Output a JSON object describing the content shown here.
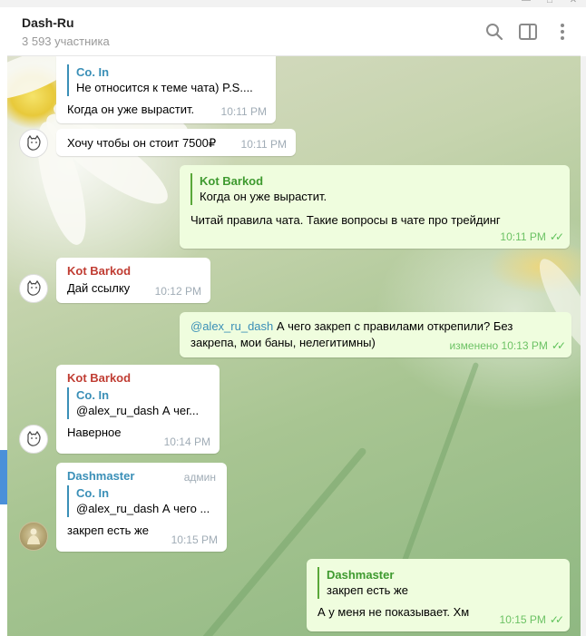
{
  "header": {
    "title": "Dash-Ru",
    "subtitle": "3 593 участника"
  },
  "icons": [
    "search-icon",
    "sidebar-toggle-icon",
    "more-vertical-icon",
    "avatar-cat-icon"
  ],
  "messages": [
    {
      "reply": {
        "name": "Co. In",
        "text": "Не относится к теме чата)  P.S...."
      },
      "text": "Когда он уже вырастит.",
      "time": "10:11 PM"
    },
    {
      "text": "Хочу чтобы он стоит 7500₽",
      "time": "10:11 PM"
    },
    {
      "reply": {
        "name": "Kot Barkod",
        "text": "Когда он уже вырастит."
      },
      "text": "Читай правила чата. Такие вопросы в чате про трейдинг",
      "time": "10:11 PM"
    },
    {
      "sender": "Kot Barkod",
      "text": "Дай ссылку",
      "time": "10:12 PM"
    },
    {
      "mention": "@alex_ru_dash",
      "text_line1": " А чего закреп с правилами открепили? Без",
      "text_line2": "закрепа, мои баны, нелегитимны)",
      "time": "изменено 10:13 PM"
    },
    {
      "sender": "Kot Barkod",
      "reply": {
        "name": "Co. In",
        "text": "@alex_ru_dash А чег..."
      },
      "text": "Наверное",
      "time": "10:14 PM"
    },
    {
      "sender": "Dashmaster",
      "badge": "админ",
      "reply": {
        "name": "Co. In",
        "text": "@alex_ru_dash А чего ..."
      },
      "text": "закреп есть же",
      "time": "10:15 PM"
    },
    {
      "reply": {
        "name": "Dashmaster",
        "text": "закреп есть же"
      },
      "text": "А у меня не показывает. Хм",
      "time": "10:15 PM"
    }
  ],
  "colors": {
    "sender_red": "#c03d33",
    "sender_blue": "#3a8fb7",
    "out_bubble": "#effdde",
    "check_green": "#5fc25a"
  }
}
